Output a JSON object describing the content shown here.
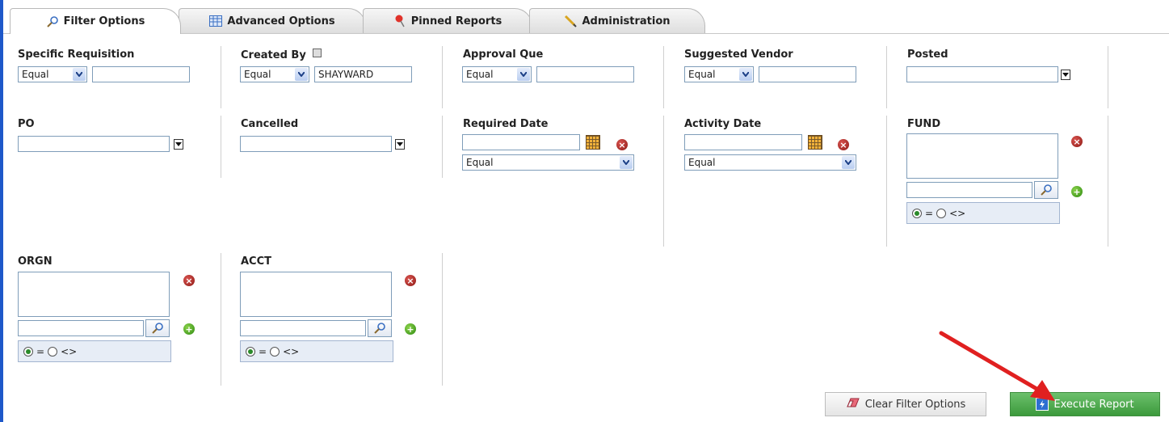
{
  "tabs": [
    {
      "label": "Filter Options",
      "icon": "magnifier-icon",
      "active": true
    },
    {
      "label": "Advanced Options",
      "icon": "table-icon",
      "active": false
    },
    {
      "label": "Pinned Reports",
      "icon": "pin-icon",
      "active": false
    },
    {
      "label": "Administration",
      "icon": "pencil-icon",
      "active": false
    }
  ],
  "filters": {
    "specific_requisition": {
      "label": "Specific Requisition",
      "operator": "Equal",
      "value": ""
    },
    "created_by": {
      "label": "Created By",
      "operator": "Equal",
      "value": "SHAYWARD"
    },
    "approval_que": {
      "label": "Approval Que",
      "operator": "Equal",
      "value": ""
    },
    "suggested_vendor": {
      "label": "Suggested Vendor",
      "operator": "Equal",
      "value": ""
    },
    "posted": {
      "label": "Posted",
      "value": ""
    },
    "po": {
      "label": "PO",
      "value": ""
    },
    "cancelled": {
      "label": "Cancelled",
      "value": ""
    },
    "required_date": {
      "label": "Required Date",
      "value": "",
      "operator": "Equal"
    },
    "activity_date": {
      "label": "Activity Date",
      "value": "",
      "operator": "Equal"
    },
    "fund": {
      "label": "FUND",
      "search_value": "",
      "radio_eq": "=",
      "radio_ne": "<>",
      "selected": "="
    },
    "orgn": {
      "label": "ORGN",
      "search_value": "",
      "radio_eq": "=",
      "radio_ne": "<>",
      "selected": "="
    },
    "acct": {
      "label": "ACCT",
      "search_value": "",
      "radio_eq": "=",
      "radio_ne": "<>",
      "selected": "="
    }
  },
  "buttons": {
    "clear": "Clear Filter Options",
    "execute": "Execute Report"
  },
  "colors": {
    "accent_blue": "#1e58c9",
    "execute_green": "#4caf50",
    "annotation_arrow": "#e02020"
  }
}
